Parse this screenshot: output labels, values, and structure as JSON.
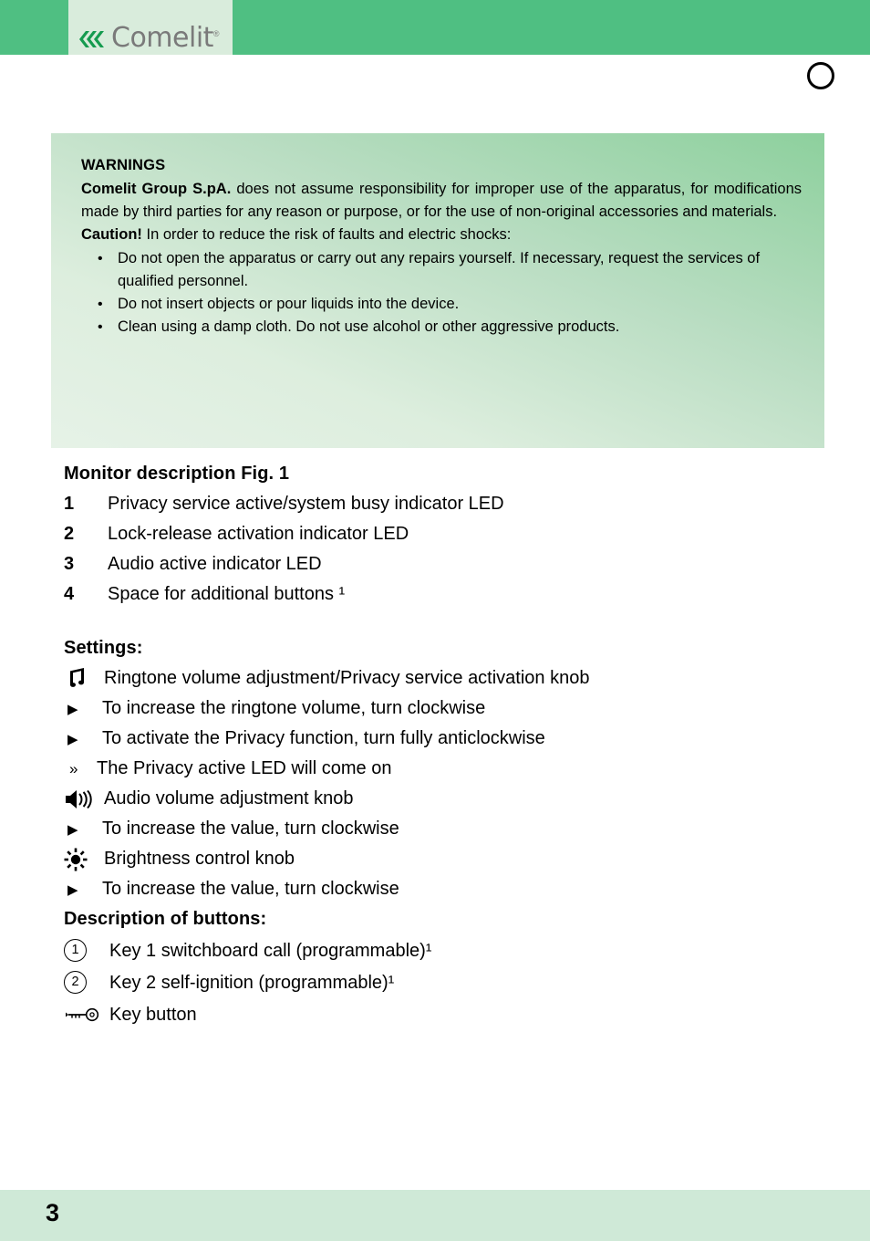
{
  "header": {
    "brand": "Comelit",
    "brand_reg": "®",
    "logo_icon": "comelit-chevron-logo"
  },
  "page_mark": {
    "icon": "circle-outline-icon"
  },
  "warnings": {
    "title": "WARNINGS",
    "company": "Comelit Group S.pA.",
    "paragraph": " does not assume responsibility for improper use of the apparatus, for modifications made by third parties for any reason or purpose, or for the use of non-original accessories and materials.",
    "caution_label": "Caution!",
    "caution_text": " In order to reduce the risk of faults and electric shocks:",
    "bullet_glyph": "•",
    "bullets": [
      "Do not open the apparatus or carry out any repairs yourself. If necessary, request the services of qualified personnel.",
      "Do not insert objects or pour liquids into the device.",
      "Clean using a damp cloth. Do not use alcohol or other aggressive products."
    ]
  },
  "monitor_description": {
    "title": "Monitor description Fig. 1",
    "items": [
      {
        "num": "1",
        "text": "Privacy service active/system busy indicator LED"
      },
      {
        "num": "2",
        "text": "Lock-release activation indicator LED"
      },
      {
        "num": "3",
        "text": "Audio active indicator LED"
      },
      {
        "num": "4",
        "text": "Space for additional buttons ¹"
      }
    ]
  },
  "settings": {
    "title": "Settings:",
    "ringtone_icon": "music-note-icon",
    "ringtone_label": "Ringtone volume adjustment/Privacy service activation knob",
    "triangle_glyph": "▶",
    "guillemet_glyph": "»",
    "ringtone_steps": [
      "To increase the ringtone volume, turn clockwise",
      "To activate the Privacy function, turn fully anticlockwise"
    ],
    "ringtone_result": "The Privacy active LED will come on",
    "audio_icon": "speaker-volume-icon",
    "audio_label": "Audio volume adjustment knob",
    "audio_step": "To increase the value, turn clockwise",
    "brightness_icon": "brightness-sun-icon",
    "brightness_label": "Brightness control knob",
    "brightness_step": "To increase the value, turn clockwise"
  },
  "buttons_description": {
    "title": "Description of buttons:",
    "items": [
      {
        "marker": "1",
        "icon": "circled-number-1-icon",
        "text": "Key 1 switchboard call (programmable)¹"
      },
      {
        "marker": "2",
        "icon": "circled-number-2-icon",
        "text": "Key 2 self-ignition (programmable)¹"
      }
    ],
    "key_icon": "key-icon",
    "key_label": "Key button"
  },
  "footer": {
    "page_number": "3"
  },
  "colors": {
    "header_green": "#4fbf82",
    "logo_panel": "#d9ecdc",
    "footer_green": "#cfe9d7",
    "warn_box_light": "#e6f2e7",
    "warn_box_dark": "#8dd09d",
    "logo_text": "#7a7a7a"
  }
}
